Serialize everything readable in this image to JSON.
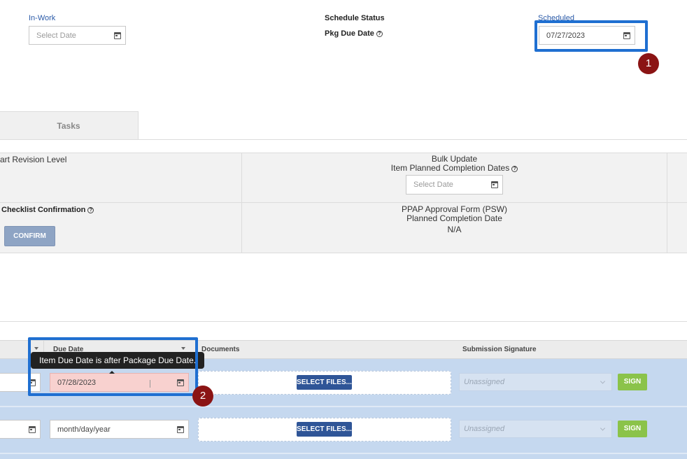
{
  "header": {
    "inwork_label": "In-Work",
    "inwork_placeholder": "Select Date",
    "schedule_status_label": "Schedule Status",
    "pkg_due_date_label": "Pkg Due Date",
    "scheduled_label": "Scheduled",
    "pkg_due_date_value": "07/27/2023"
  },
  "callouts": {
    "one": "1",
    "two": "2"
  },
  "tabs": [
    {
      "label": "Tasks"
    }
  ],
  "info": {
    "part_revision_label": "art Revision Level",
    "bulk_update_title": "Bulk Update",
    "bulk_update_subtitle": "Item Planned Completion Dates",
    "bulk_update_placeholder": "Select Date",
    "checklist_label": "Checklist Confirmation",
    "confirm_button": "CONFIRM",
    "ppap_title": "PPAP Approval Form (PSW)",
    "ppap_subtitle": "Planned Completion Date",
    "ppap_value": "N/A"
  },
  "table": {
    "columns": {
      "due_date": "Due Date",
      "documents": "Documents",
      "signature": "Submission Signature"
    },
    "tooltip": "Item Due Date is after Package Due Date.",
    "rows": [
      {
        "due_date": "07/28/2023",
        "select_files": "SELECT FILES...",
        "signature": "Unassigned",
        "sign": "SIGN"
      },
      {
        "due_date": "month/day/year",
        "select_files": "SELECT FILES...",
        "signature": "Unassigned",
        "sign": "SIGN"
      }
    ]
  },
  "icons": {
    "calendar": "calendar-icon",
    "help": "help-circle-icon",
    "chevron": "chevron-down-icon",
    "caret": "sort-caret-icon"
  },
  "colors": {
    "accent": "#1f6fd1",
    "badge": "#8b1414",
    "sign": "#8bc34a",
    "select_files": "#2f5597",
    "row": "#c5d8ef",
    "error": "#f8d1cf"
  }
}
